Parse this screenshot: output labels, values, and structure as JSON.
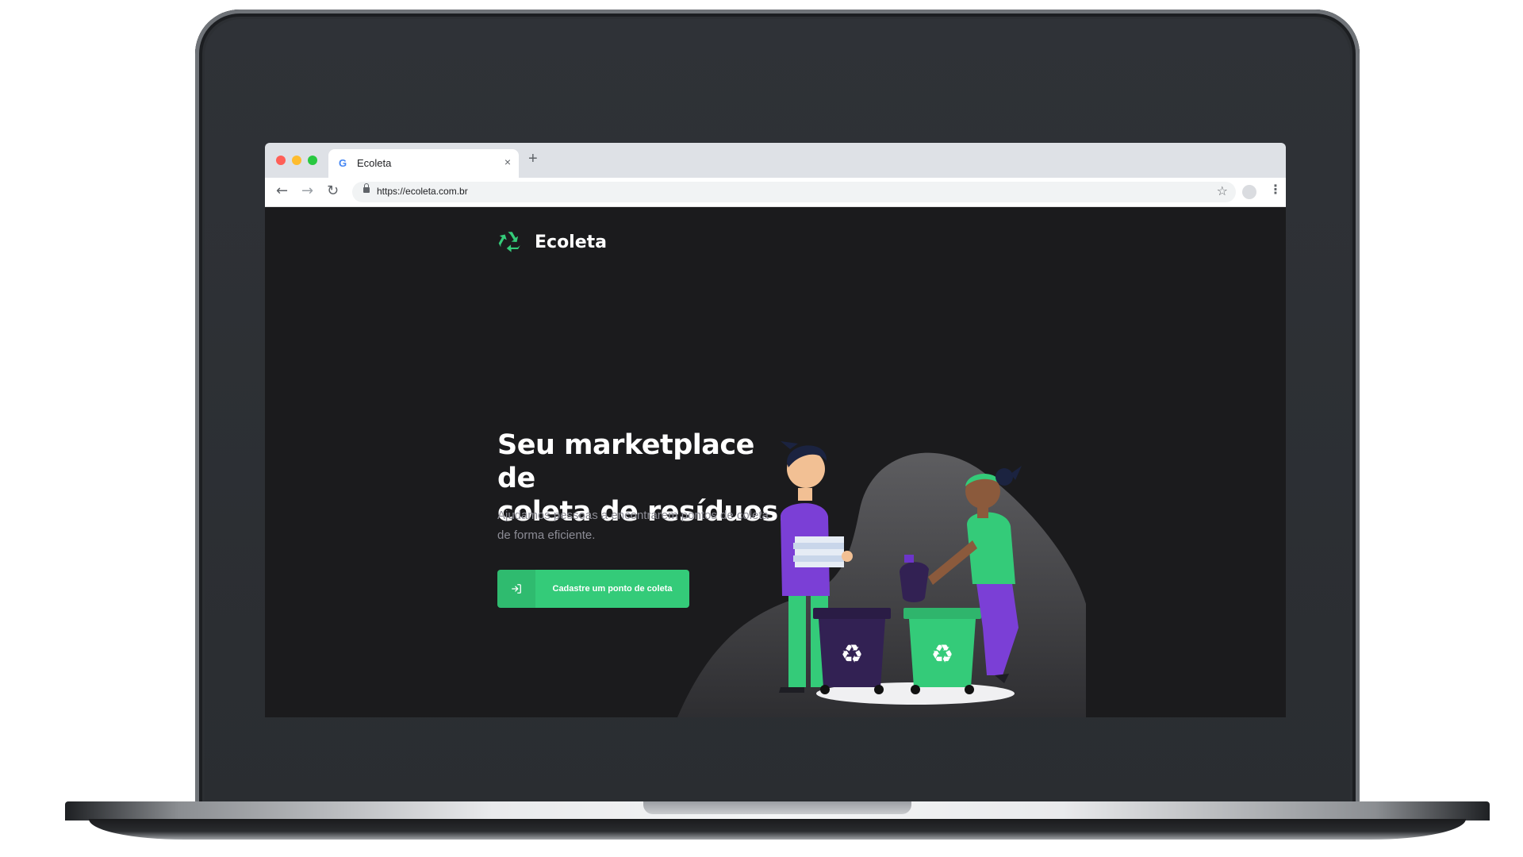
{
  "browser": {
    "tab": {
      "title": "Ecoleta",
      "favicon": "google-g-icon",
      "close_glyph": "×"
    },
    "new_tab_glyph": "+",
    "toolbar": {
      "back_icon": "arrow-left-icon",
      "forward_icon": "arrow-right-icon",
      "reload_icon": "reload-icon",
      "url": "https://ecoleta.com.br",
      "bookmark_icon": "star-icon",
      "menu_icon": "kebab-menu-icon"
    }
  },
  "page": {
    "brand": {
      "name": "Ecoleta",
      "icon": "recycle-icon",
      "color": "#34cb79"
    },
    "hero": {
      "headline_line1": "Seu marketplace de",
      "headline_line2": "coleta de resíduos.",
      "subtitle_line1": "Ajudamos pessoas a encontrarem pontos de coleta",
      "subtitle_line2": "de forma eficiente.",
      "cta_label": "Cadastre um ponto de coleta",
      "cta_icon": "log-in-icon"
    },
    "colors": {
      "background": "#1b1b1d",
      "accent": "#34cb79",
      "purple": "#6c35c9",
      "bin_dark": "#322153"
    }
  }
}
